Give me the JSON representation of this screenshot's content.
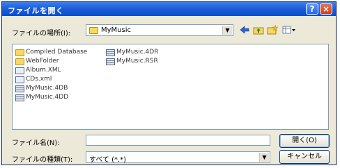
{
  "window": {
    "title": "ファイルを開く"
  },
  "titlebar_buttons": {
    "help": "?",
    "close": "×"
  },
  "look_in": {
    "label": "ファイルの場所(I):",
    "value": "MyMusic"
  },
  "files": [
    {
      "name": "Compiled Database",
      "type": "folder"
    },
    {
      "name": "WebFolder",
      "type": "folder"
    },
    {
      "name": "Album.XML",
      "type": "document"
    },
    {
      "name": "CDs.xml",
      "type": "document"
    },
    {
      "name": "MyMusic.4DB",
      "type": "database"
    },
    {
      "name": "MyMusic.4DD",
      "type": "database"
    },
    {
      "name": "MyMusic.4DR",
      "type": "database"
    },
    {
      "name": "MyMusic.RSR",
      "type": "database"
    }
  ],
  "filename": {
    "label": "ファイル名(N):",
    "value": ""
  },
  "filetype": {
    "label": "ファイルの種類(T):",
    "value": "すべて (*.*)"
  },
  "buttons": {
    "open": "開く(O)",
    "cancel": "キャンセル"
  },
  "colors": {
    "title_bar": "#1e5fd8",
    "dialog_bg": "#ece9d8",
    "field_border": "#7f9db9",
    "folder": "#f7d860"
  }
}
